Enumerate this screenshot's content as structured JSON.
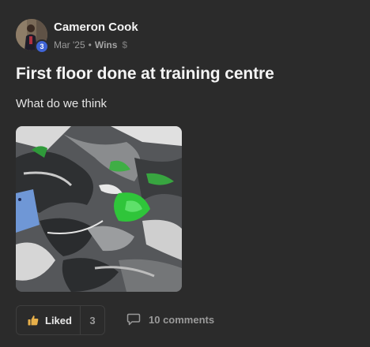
{
  "author": {
    "name": "Cameron Cook",
    "level": "3"
  },
  "meta": {
    "date": "Mar '25",
    "separator": "•",
    "category": "Wins",
    "icons": [
      "level-badge",
      "dollar-icon"
    ]
  },
  "post": {
    "title": "First floor done at training centre",
    "body": "What do we think"
  },
  "actions": {
    "like_label": "Liked",
    "like_count": "3",
    "comments_label": "10 comments",
    "icons": [
      "thumbs-up-icon",
      "comment-bubble-icon"
    ]
  },
  "colors": {
    "background": "#2b2b2b",
    "badge": "#3f64d6",
    "like_icon": "#e8b04a",
    "muted_text": "#9a9a9a"
  }
}
